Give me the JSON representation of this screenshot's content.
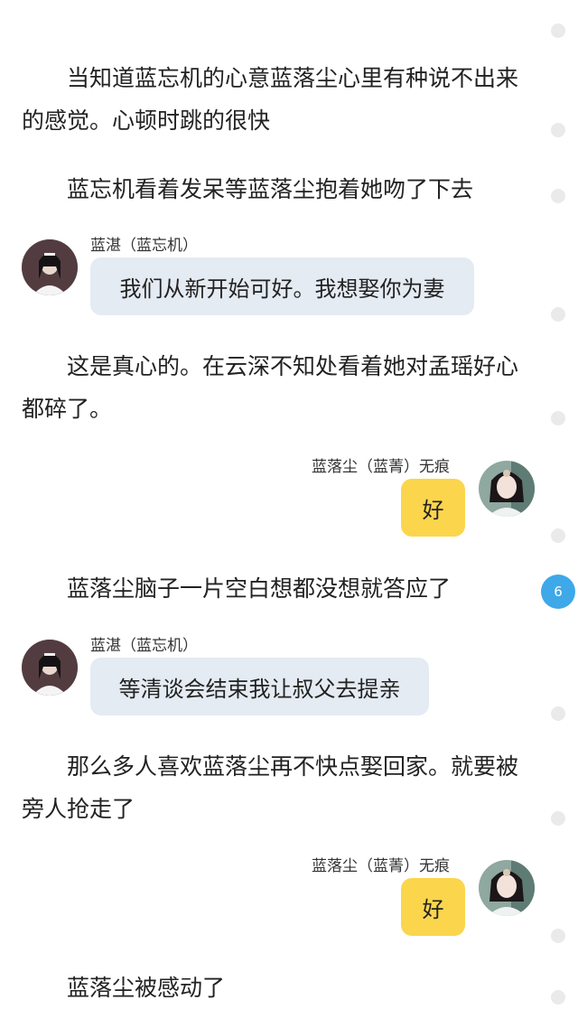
{
  "paragraphs": [
    "当知道蓝忘机的心意蓝落尘心里有种说不出来的感觉。心顿时跳的很快",
    "蓝忘机看着发呆等蓝落尘抱着她吻了下去",
    "这是真心的。在云深不知处看着她对孟瑶好心都碎了。",
    "蓝落尘脑子一片空白想都没想就答应了",
    "那么多人喜欢蓝落尘再不快点娶回家。就要被旁人抢走了",
    "蓝落尘被感动了"
  ],
  "messages": [
    {
      "speaker": "蓝湛（蓝忘机）",
      "text": "我们从新开始可好。我想娶你为妻",
      "side": "left"
    },
    {
      "speaker": "蓝落尘（蓝菁）无痕",
      "text": "好",
      "side": "right"
    },
    {
      "speaker": "蓝湛（蓝忘机）",
      "text": "等清谈会结束我让叔父去提亲",
      "side": "left"
    },
    {
      "speaker": "蓝落尘（蓝菁）无痕",
      "text": "好",
      "side": "right"
    }
  ],
  "scroll_indicator": {
    "badge": "6"
  },
  "colors": {
    "left_bubble": "#e4ebf2",
    "right_bubble": "#fbd54c",
    "badge": "#3ea8e8"
  }
}
